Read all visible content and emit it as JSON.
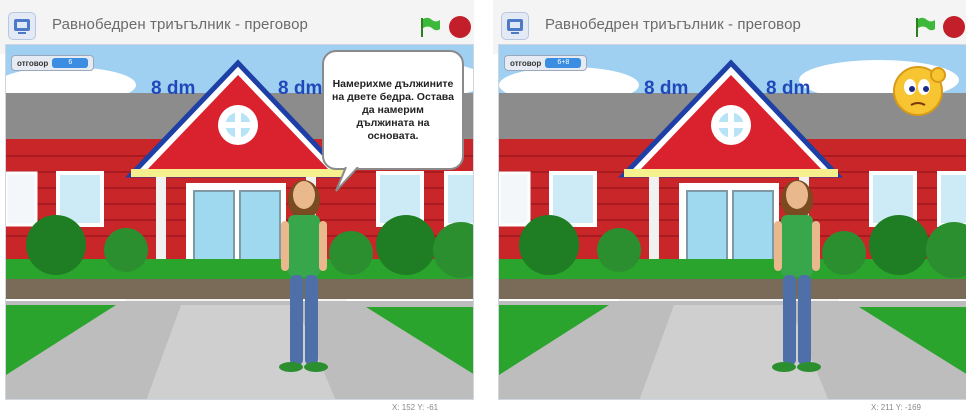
{
  "colors": {
    "sky": "#9fd0f2",
    "roof": "#d9222e",
    "wall": "#c9262a",
    "side_color": "#2148b8",
    "grass": "#2aa42d",
    "road": "#bdbdbd"
  },
  "panels": [
    {
      "title": "Равнобедрен триъгълник - преговор",
      "variable": {
        "name": "отговор",
        "value": "6"
      },
      "side_labels": [
        "8 dm",
        "8 dm"
      ],
      "speech": "Намерихме дължините на двете бедра. Остава да намерим дължината на основата.",
      "coords": "X: 152  Y: -61"
    },
    {
      "title": "Равнобедрен триъгълник - преговор",
      "variable": {
        "name": "отговор",
        "value": "6+8"
      },
      "side_labels": [
        "8 dm",
        "8 dm"
      ],
      "coords": "X: 211  Y: -169"
    }
  ],
  "icons": {
    "fullscreen": "fullscreen-icon",
    "green_flag": "green-flag-icon",
    "stop": "stop-icon",
    "thinking": "thinking-face-icon"
  }
}
